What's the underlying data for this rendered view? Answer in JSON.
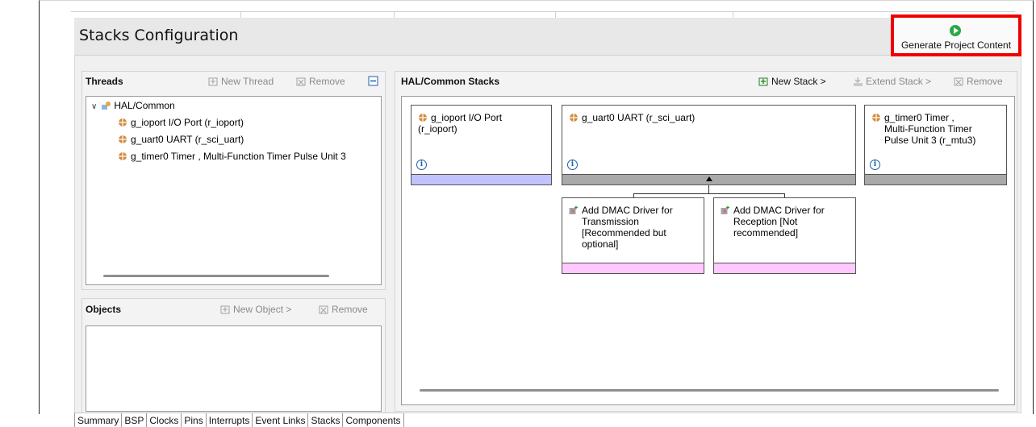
{
  "editor": {
    "title": "Stacks Configuration",
    "generate_button_label": "Generate Project Content"
  },
  "threads": {
    "header": "Threads",
    "new_thread": "New Thread",
    "remove": "Remove",
    "tree": {
      "root": "HAL/Common",
      "items": [
        "g_ioport I/O Port (r_ioport)",
        "g_uart0 UART (r_sci_uart)",
        "g_timer0 Timer , Multi-Function Timer Pulse Unit 3"
      ]
    }
  },
  "objects": {
    "header": "Objects",
    "new_object": "New Object >",
    "remove": "Remove"
  },
  "stacks": {
    "header": "HAL/Common Stacks",
    "new_stack": "New Stack >",
    "extend_stack": "Extend Stack >",
    "remove": "Remove",
    "modules": [
      {
        "name_line1": "g_ioport I/O Port",
        "name_line2": "(r_ioport)"
      },
      {
        "name_line1": "g_uart0 UART (r_sci_uart)"
      },
      {
        "name_line1": "g_timer0 Timer ,",
        "name_line2": "Multi-Function Timer",
        "name_line3": "Pulse Unit 3 (r_mtu3)"
      }
    ],
    "dependencies": [
      {
        "line1": "Add DMAC Driver for",
        "line2": "Transmission",
        "line3": "[Recommended but",
        "line4": "optional]"
      },
      {
        "line1": "Add DMAC Driver for",
        "line2": "Reception [Not",
        "line3": "recommended]"
      }
    ]
  },
  "tabs": [
    "Summary",
    "BSP",
    "Clocks",
    "Pins",
    "Interrupts",
    "Event Links",
    "Stacks",
    "Components"
  ],
  "colors": {
    "highlight": "#ee0000",
    "module_bar": "#c2c2ff",
    "dependency_bar": "#ffc8ff",
    "info_icon": "#1c5fb0",
    "generate_icon": "#2aa845"
  },
  "icons": {
    "generate": "play-circle-icon",
    "module": "component-icon",
    "dependency": "add-module-icon",
    "info": "info-icon"
  }
}
